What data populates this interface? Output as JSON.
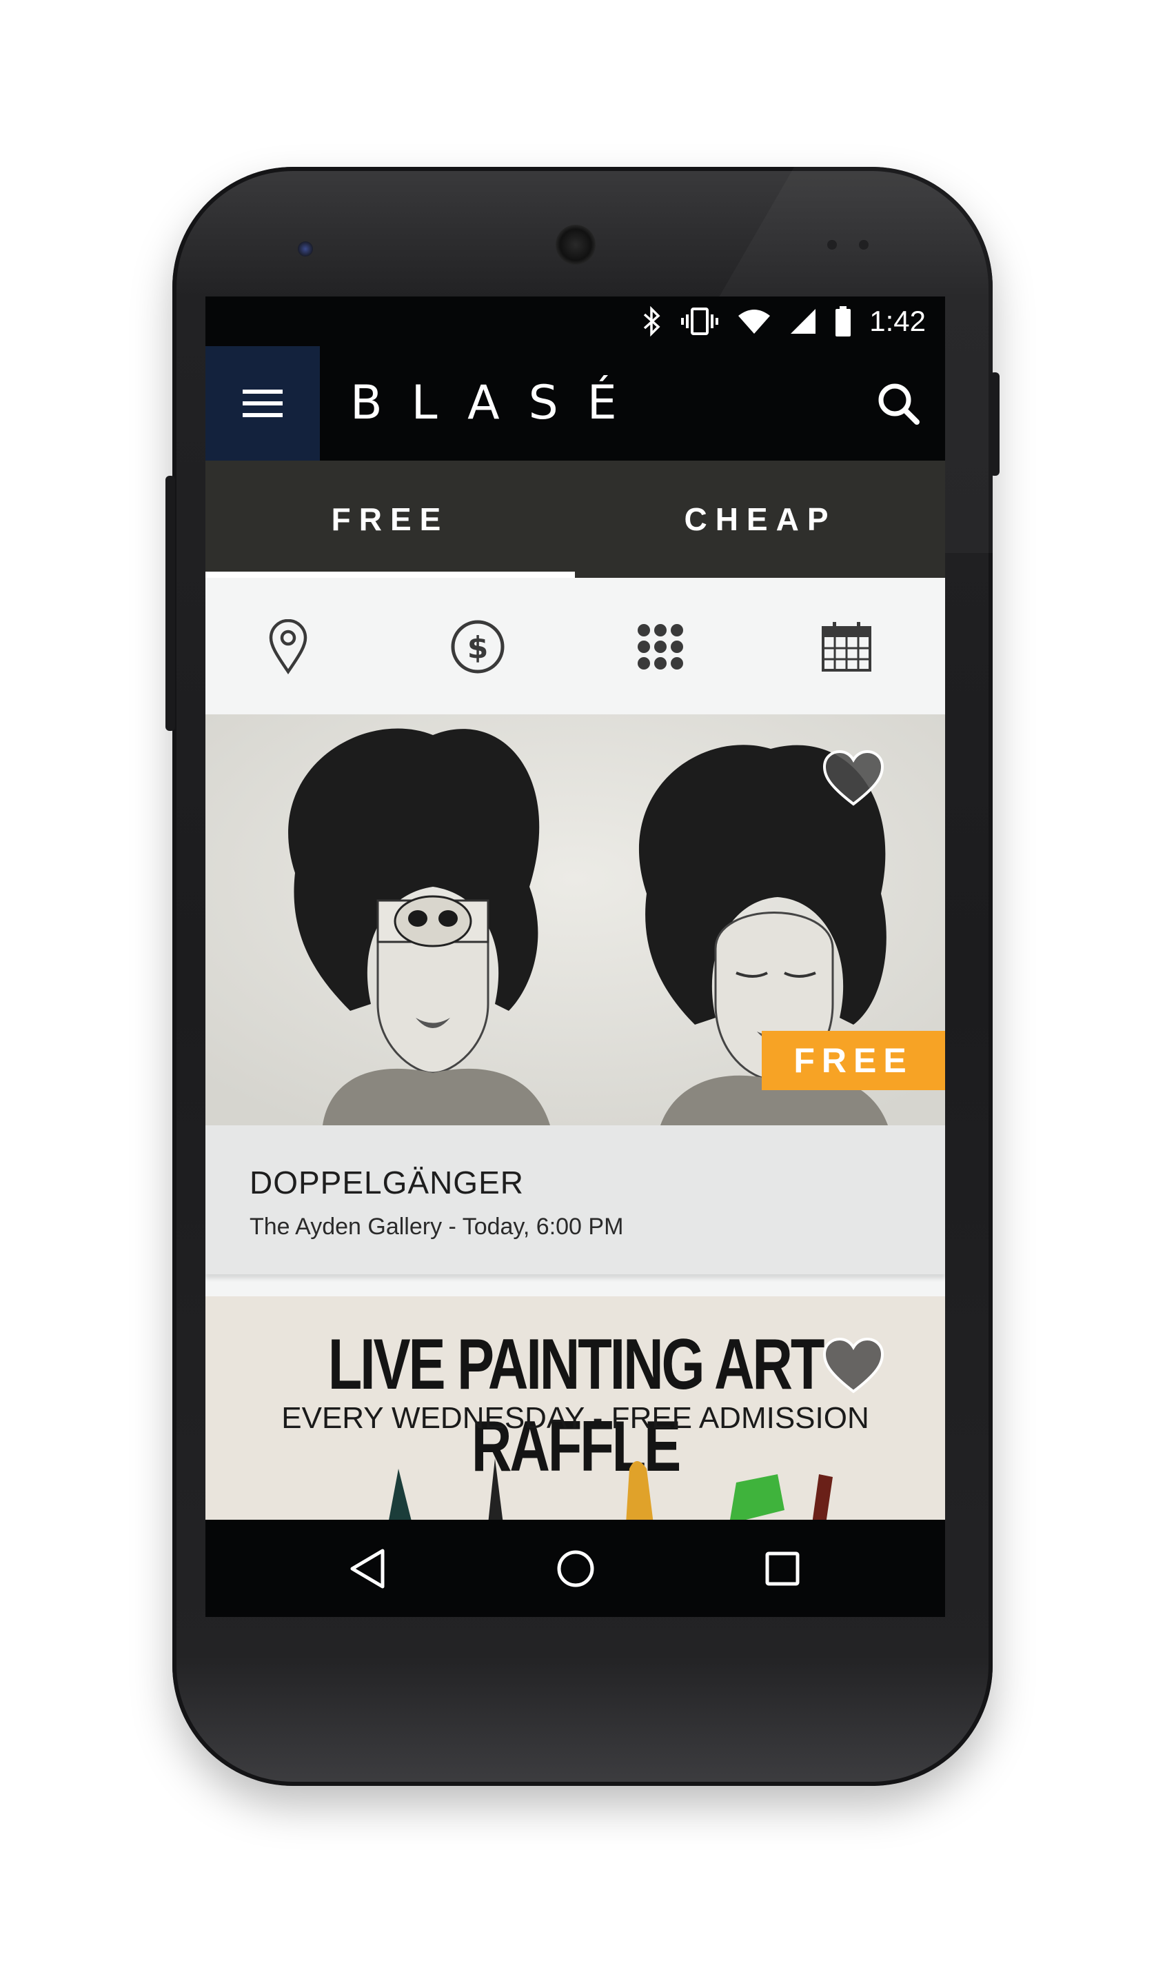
{
  "status_bar": {
    "time": "1:42",
    "icons": [
      "bluetooth-icon",
      "vibrate-icon",
      "wifi-icon",
      "signal-icon",
      "battery-icon"
    ]
  },
  "app_bar": {
    "menu_icon": "menu-icon",
    "brand": "BLASÉ",
    "search_icon": "search-icon"
  },
  "tabs": [
    {
      "label": "FREE",
      "selected": true
    },
    {
      "label": "CHEAP",
      "selected": false
    }
  ],
  "filters": [
    "location-pin-icon",
    "dollar-icon",
    "grid-icon",
    "calendar-icon"
  ],
  "events": [
    {
      "title": "DOPPELGÄNGER",
      "subtitle": "The Ayden Gallery - Today, 6:00 PM",
      "badge": "FREE",
      "favorite_icon": "heart-icon"
    },
    {
      "poster_headline": "LIVE PAINTING ART RAFFLE",
      "poster_subline": "EVERY WEDNESDAY - FREE ADMISSION",
      "favorite_icon": "heart-icon"
    }
  ],
  "nav_bar": [
    "back-icon",
    "home-icon",
    "recents-icon"
  ],
  "colors": {
    "app_bar": "#050607",
    "menu_button": "#13223d",
    "tab_bar": "#2f2f2c",
    "badge": "#f7a325",
    "card_info": "#e6e7e7"
  }
}
